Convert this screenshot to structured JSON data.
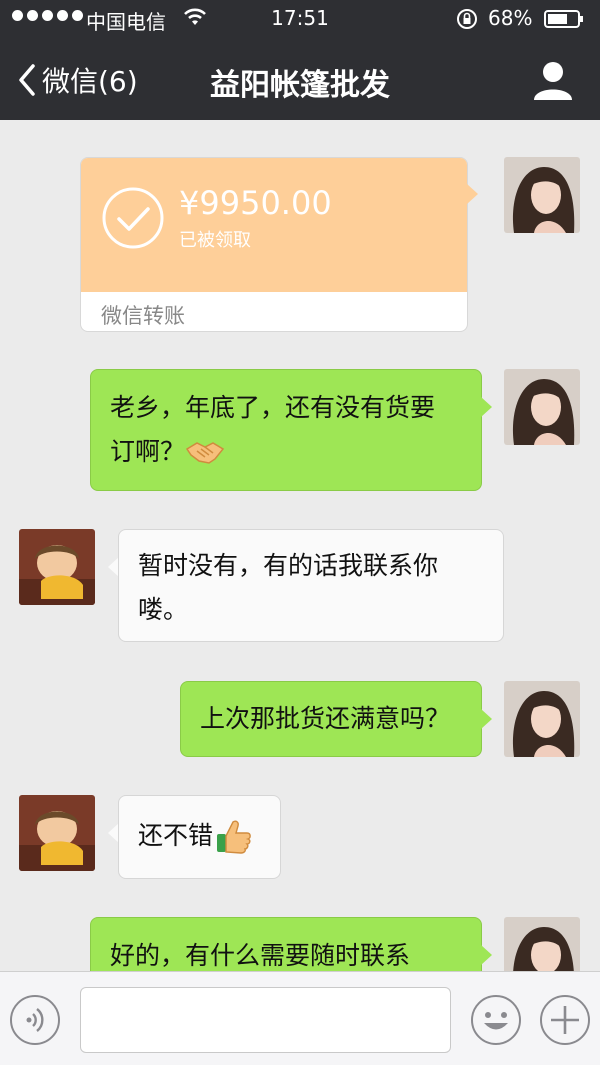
{
  "status_bar": {
    "carrier": "中国电信",
    "time": "17:51",
    "battery_percent": "68%",
    "battery_level": 0.68
  },
  "nav": {
    "back_label": "微信(6)",
    "title": "益阳帐篷批发"
  },
  "transfer": {
    "amount": "¥9950.00",
    "status": "已被领取",
    "footer": "微信转账",
    "color": "#fecf99"
  },
  "messages": [
    {
      "sender": "me",
      "text_line1": "老乡，年底了，还有没有货要",
      "text_line2": "订啊？",
      "emoji": "handshake-emoji"
    },
    {
      "sender": "them",
      "text_line1": "暂时没有，有的话我联系你",
      "text_line2": "喽。"
    },
    {
      "sender": "me",
      "text": "上次那批货还满意吗？"
    },
    {
      "sender": "them",
      "text": "还不错",
      "emoji": "thumbs-up-emoji"
    },
    {
      "sender": "me",
      "text": "好的，有什么需要随时联系"
    }
  ],
  "input": {
    "placeholder": ""
  },
  "colors": {
    "nav_bg": "#2e2f33",
    "chat_bg": "#ebebeb",
    "my_bubble": "#9ee655",
    "their_bubble": "#fafafa"
  }
}
